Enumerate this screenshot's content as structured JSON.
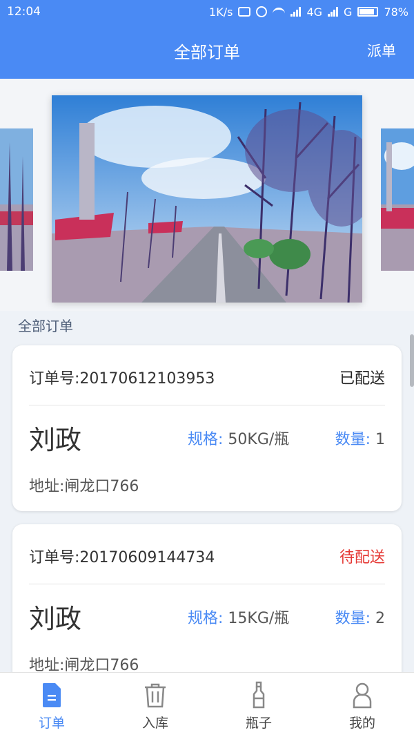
{
  "status_bar": {
    "time": "12:04",
    "speed": "1K/s",
    "network1": "4G",
    "network2": "G",
    "battery": "78%"
  },
  "header": {
    "title": "全部订单",
    "action": "派单"
  },
  "banner": {
    "slides": [
      "tree-lined road photo"
    ]
  },
  "section_title": "全部订单",
  "orders": [
    {
      "order_no": "订单号:20170612103953",
      "status": "已配送",
      "customer": "刘政",
      "spec_label": "规格:",
      "spec_value": "50KG/瓶",
      "qty_label": "数量:",
      "qty_value": "1",
      "address": "地址:闸龙口766"
    },
    {
      "order_no": "订单号:20170609144734",
      "status": "待配送",
      "customer": "刘政",
      "spec_label": "规格:",
      "spec_value": "15KG/瓶",
      "qty_label": "数量:",
      "qty_value": "2",
      "address": "地址:闸龙口766"
    }
  ],
  "nav": {
    "items": [
      {
        "label": "订单",
        "icon": "document-icon",
        "active": true
      },
      {
        "label": "入库",
        "icon": "trash-icon",
        "active": false
      },
      {
        "label": "瓶子",
        "icon": "bottle-icon",
        "active": false
      },
      {
        "label": "我的",
        "icon": "person-icon",
        "active": false
      }
    ]
  },
  "colors": {
    "primary": "#4a8af4",
    "pending": "#e53935"
  }
}
